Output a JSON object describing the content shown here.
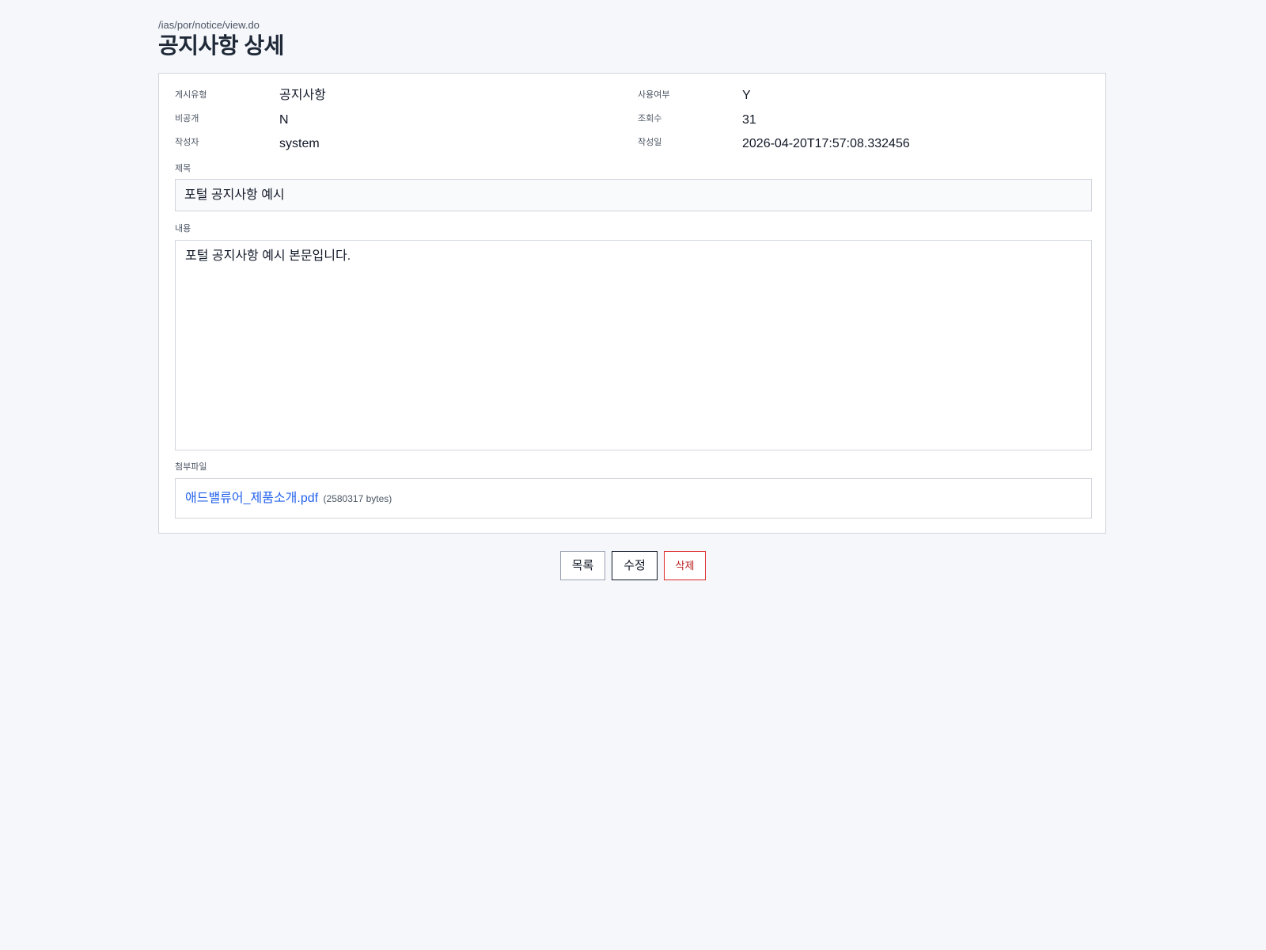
{
  "header": {
    "path": "/ias/por/notice/view.do",
    "title": "공지사항 상세"
  },
  "meta": {
    "post_type_label": "게시유형",
    "post_type_value": "공지사항",
    "use_yn_label": "사용여부",
    "use_yn_value": "Y",
    "private_label": "비공개",
    "private_value": "N",
    "views_label": "조회수",
    "views_value": "31",
    "author_label": "작성자",
    "author_value": "system",
    "created_label": "작성일",
    "created_value": "2026-04-20T17:57:08.332456"
  },
  "subject": {
    "label": "제목",
    "value": "포털 공지사항 예시"
  },
  "content": {
    "label": "내용",
    "value": "포털 공지사항 예시 본문입니다."
  },
  "attachment": {
    "label": "첨부파일",
    "file_name": "애드밸류어_제품소개.pdf",
    "file_size": "(2580317 bytes)"
  },
  "actions": {
    "list_label": "목록",
    "edit_label": "수정",
    "delete_label": "삭제"
  },
  "colors": {
    "background": "#f5f7fb",
    "link": "#2563eb",
    "danger": "#b91c1c"
  }
}
